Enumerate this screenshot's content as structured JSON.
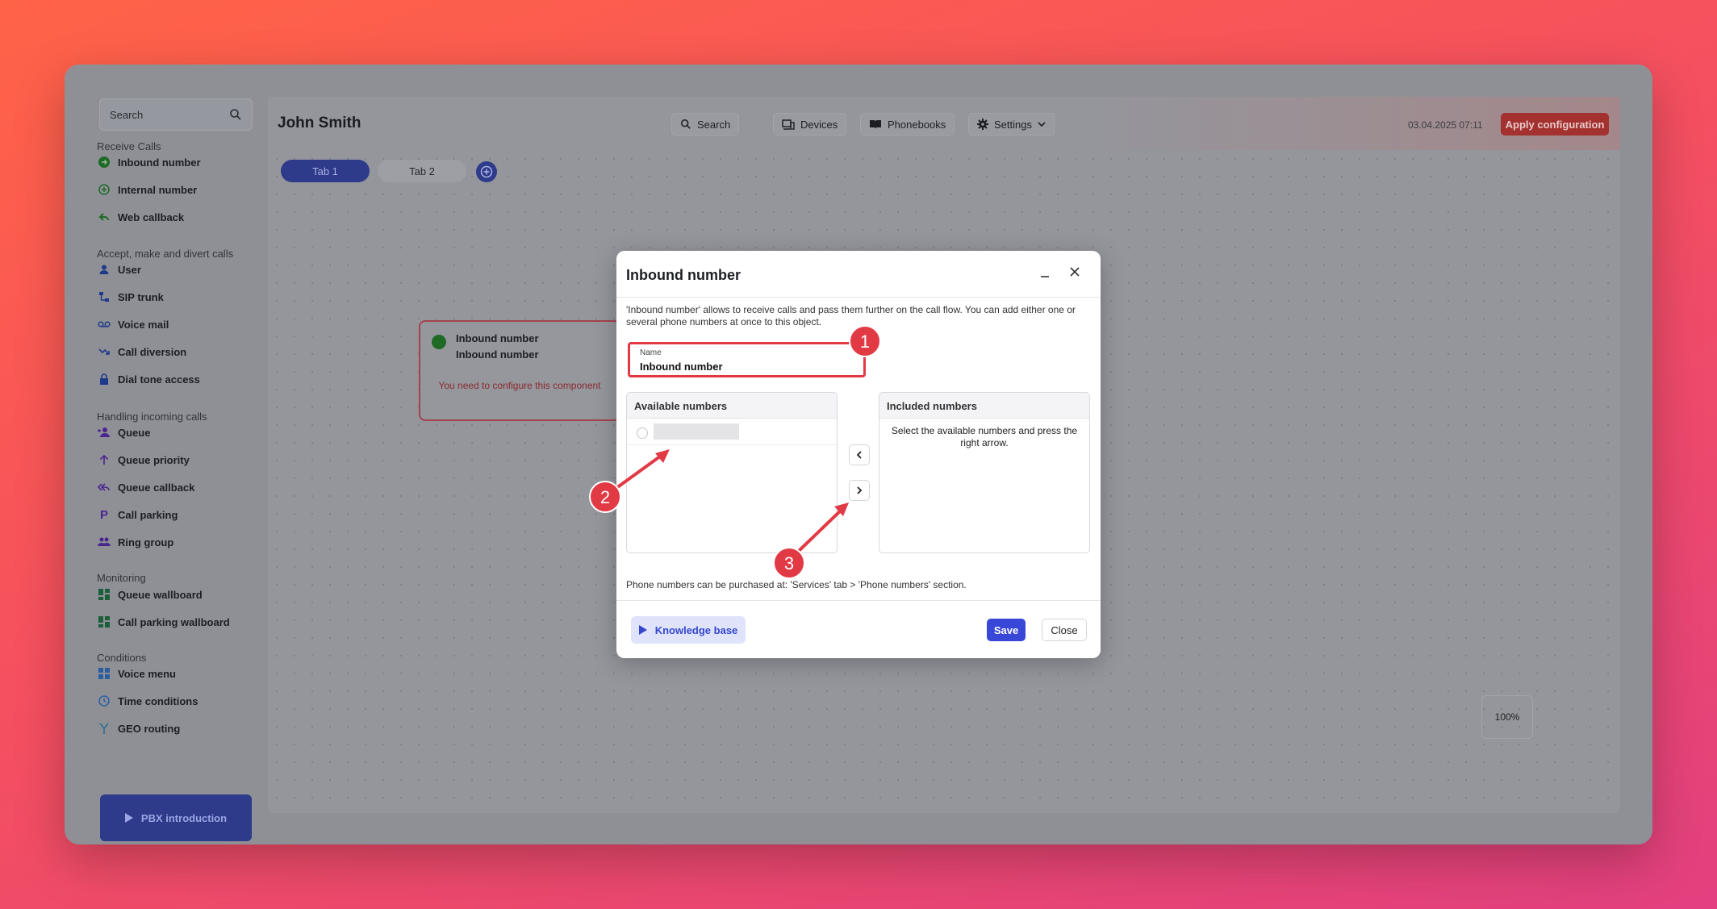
{
  "sidebar": {
    "search_placeholder": "Search",
    "groups": [
      {
        "title": "Receive Calls",
        "items": [
          {
            "label": "Inbound number",
            "icon": "arrow-circle-icon"
          },
          {
            "label": "Internal number",
            "icon": "plus-circle-icon"
          },
          {
            "label": "Web callback",
            "icon": "reply-icon"
          }
        ]
      },
      {
        "title": "Accept, make and divert calls",
        "items": [
          {
            "label": "User",
            "icon": "user-icon"
          },
          {
            "label": "SIP trunk",
            "icon": "network-icon"
          },
          {
            "label": "Voice mail",
            "icon": "voicemail-icon"
          },
          {
            "label": "Call diversion",
            "icon": "diversion-icon"
          },
          {
            "label": "Dial tone access",
            "icon": "lock-icon"
          }
        ]
      },
      {
        "title": "Handling incoming calls",
        "items": [
          {
            "label": "Queue",
            "icon": "queue-icon"
          },
          {
            "label": "Queue priority",
            "icon": "arrow-up-icon"
          },
          {
            "label": "Queue callback",
            "icon": "reply-all-icon"
          },
          {
            "label": "Call parking",
            "icon": "parking-icon"
          },
          {
            "label": "Ring group",
            "icon": "group-icon"
          }
        ]
      },
      {
        "title": "Monitoring",
        "items": [
          {
            "label": "Queue wallboard",
            "icon": "dashboard-icon"
          },
          {
            "label": "Call parking wallboard",
            "icon": "dashboard-icon"
          }
        ]
      },
      {
        "title": "Conditions",
        "items": [
          {
            "label": "Voice menu",
            "icon": "grid-icon"
          },
          {
            "label": "Time conditions",
            "icon": "clock-icon"
          },
          {
            "label": "GEO routing",
            "icon": "fork-icon"
          }
        ]
      }
    ],
    "pbx_intro_label": "PBX introduction"
  },
  "header": {
    "user_name": "John Smith",
    "search_label": "Search",
    "devices_label": "Devices",
    "phonebooks_label": "Phonebooks",
    "settings_label": "Settings",
    "datetime": "03.04.2025 07:11",
    "apply_label": "Apply configuration"
  },
  "tabs": {
    "tab1": "Tab 1",
    "tab2": "Tab 2"
  },
  "node": {
    "title": "Inbound number",
    "subtitle": "Inbound number",
    "warning": "You need to configure this component"
  },
  "zoom": "100%",
  "modal": {
    "title": "Inbound number",
    "description": "'Inbound number' allows to receive calls and pass them further on the call flow. You can add either one or several phone numbers at once to this object.",
    "name_label": "Name",
    "name_value": "Inbound number",
    "available_header": "Available numbers",
    "included_header": "Included numbers",
    "included_empty": "Select the available numbers and press the right arrow.",
    "footnote": "Phone numbers can be purchased at: 'Services' tab > 'Phone numbers' section.",
    "kb_label": "Knowledge base",
    "save_label": "Save",
    "close_label": "Close"
  },
  "annotations": [
    "1",
    "2",
    "3"
  ],
  "colors": {
    "accent": "#3847d8",
    "annotation": "#e23a44",
    "apply": "#a3312f"
  }
}
